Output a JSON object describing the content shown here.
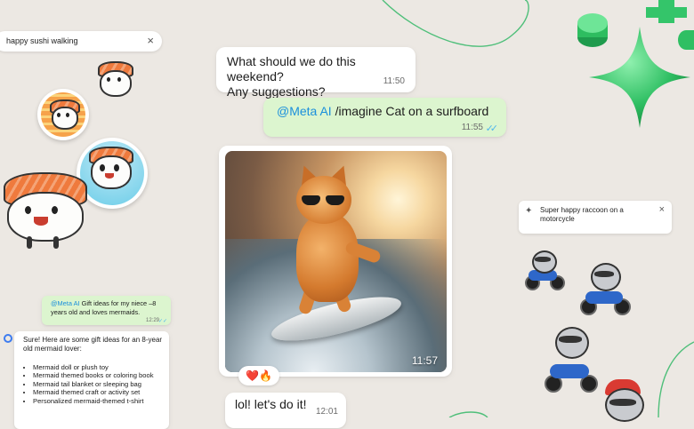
{
  "sticker_search": {
    "query": "happy sushi walking",
    "close_icon": "×"
  },
  "raccoon_search": {
    "query": "Super happy raccoon on a motorcycle",
    "close_icon": "×",
    "spark_icon": "✦"
  },
  "messages": {
    "m1": {
      "text_line1": "What should we do this weekend?",
      "text_line2": "Any suggestions?",
      "time": "11:50"
    },
    "m2": {
      "mention": "@Meta AI",
      "text": " /imagine Cat on a surfboard",
      "time": "11:55",
      "ticks": "✓✓"
    },
    "m3": {
      "time": "11:57",
      "reactions": "❤️🔥"
    },
    "m4": {
      "text": "lol! let's do it!",
      "time": "12:01"
    }
  },
  "side_chat": {
    "user_msg": {
      "mention": "@Meta AI",
      "text": " Gift ideas for my niece –8 years old and loves mermaids.",
      "time": "12:29",
      "ticks": "✓✓"
    },
    "ai_msg": {
      "intro": "Sure! Here are some gift ideas for an 8-year old mermaid lover:",
      "items": [
        "Mermaid doll or plush toy",
        "Mermaid themed books or coloring book",
        "Mermaid tail blanket or sleeping bag",
        "Mermaid themed craft or activity set",
        "Personalized mermaid-themed t-shirt"
      ]
    }
  },
  "colors": {
    "background": "#ece8e3",
    "outgoing_bubble": "#dcf5cf",
    "mention": "#1a8fdc",
    "accent_green": "#25a25a"
  }
}
